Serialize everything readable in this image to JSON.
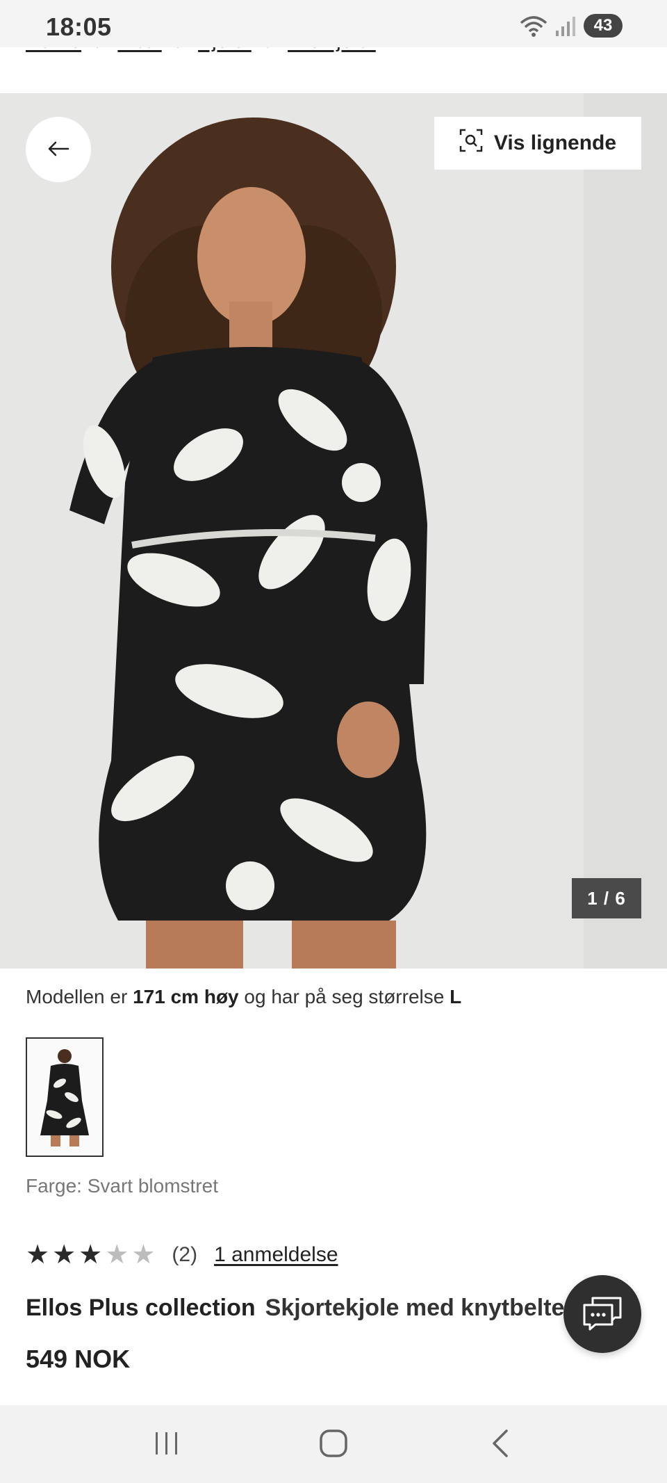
{
  "status_bar": {
    "time": "18:05",
    "battery": "43",
    "icons": [
      "wifi-icon",
      "signal-icon"
    ]
  },
  "breadcrumb": {
    "items": [
      "Dame",
      "Klær",
      "Kjoler",
      "Midikjoler"
    ],
    "separator": "/"
  },
  "hero": {
    "similar_label": "Vis lignende",
    "counter": "1 / 6",
    "icons": [
      "back-arrow-icon",
      "visual-search-icon"
    ]
  },
  "product": {
    "model_prefix": "Modellen er",
    "model_height": "171 cm høy",
    "model_middle": "og har på seg størrelse",
    "model_size": "L",
    "color_label": "Farge: Svart blomstret",
    "rating": {
      "value": 3,
      "max": 5,
      "count": "(2)",
      "reviews_link": "1 anmeldelse"
    },
    "brand": "Ellos Plus collection",
    "name": "Skjortekjole med knytbelte",
    "price": "549 NOK"
  },
  "chat": {
    "icon": "chat-icon"
  },
  "nav_bar": {
    "icons": [
      "recent-apps-icon",
      "home-icon",
      "back-icon"
    ]
  },
  "colors": {
    "counter_bg": "#4a4a4a",
    "chat_bg": "#2f2f2f",
    "photo_bg": "#e6e6e5"
  }
}
